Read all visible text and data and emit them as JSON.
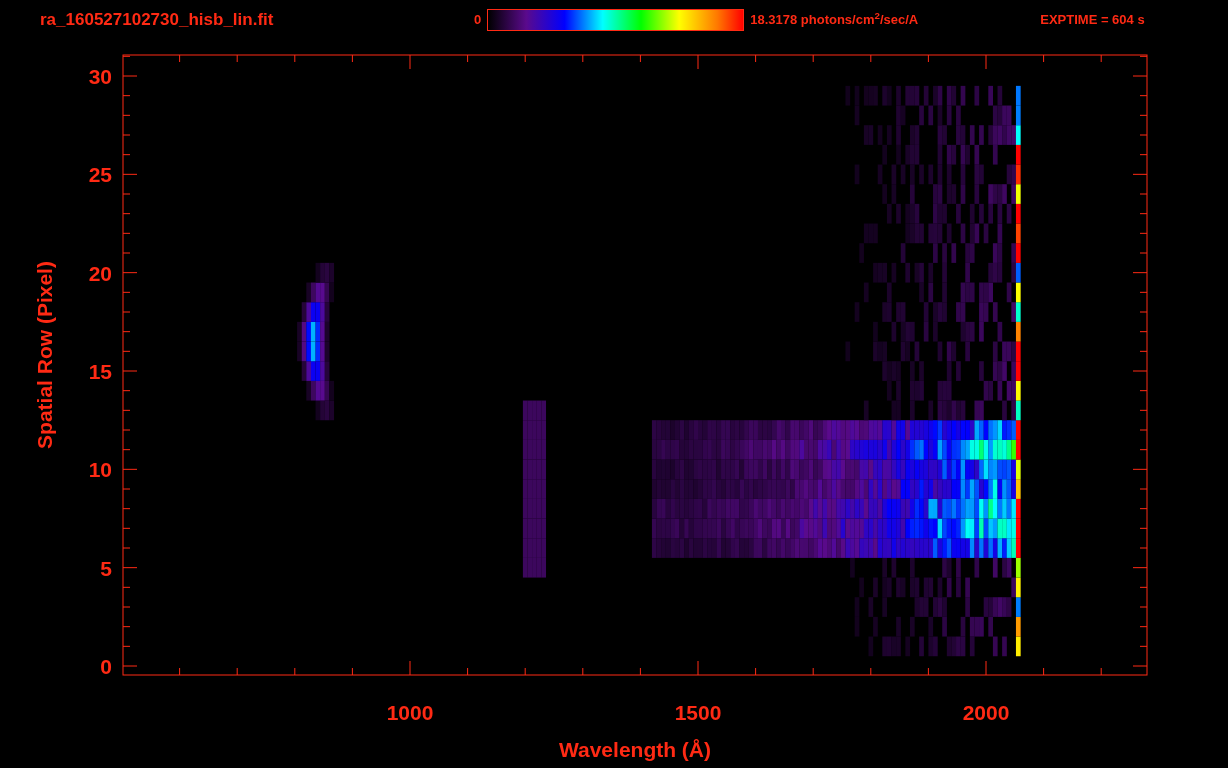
{
  "title": "ra_160527102730_hisb_lin.fit",
  "colorbar": {
    "min_label": "0",
    "max_label": "18.3178 photons/cm$^{2}$/sec/A"
  },
  "exposure": "EXPTIME = 604 s",
  "plot": {
    "xlabel": "Wavelength (Å)",
    "ylabel": "Spatial Row (Pixel)",
    "xticks": [
      "1000",
      "1500",
      "2000"
    ],
    "yticks": [
      "30",
      "25",
      "20",
      "15",
      "10",
      "5",
      "0"
    ]
  }
}
